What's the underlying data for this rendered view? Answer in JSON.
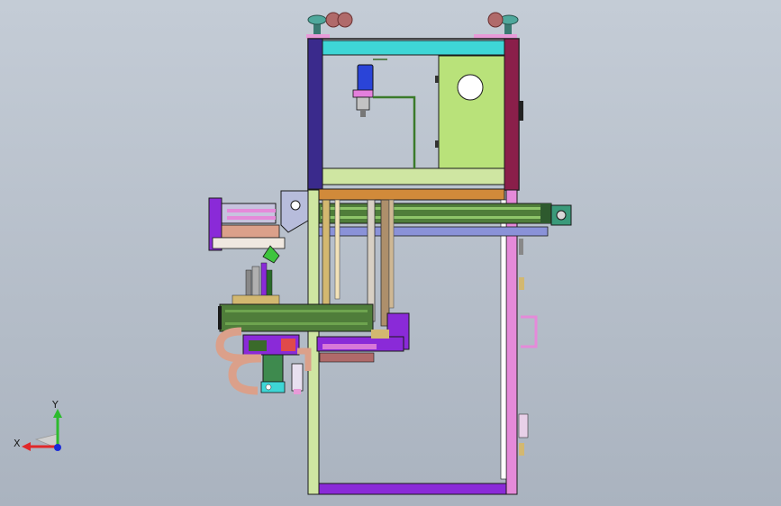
{
  "viewport": {
    "background_top": "#c4ccd6",
    "background_bottom": "#aab3bf"
  },
  "triad": {
    "x_label": "X",
    "y_label": "Y",
    "x_color": "#e0282a",
    "y_color": "#2dbb2d",
    "z_color": "#1a2bd8"
  },
  "palette": {
    "frame_green": "#cfe6a2",
    "frame_purple": "#8a2ad8",
    "frame_pink": "#e58ad9",
    "frame_navy": "#3a2a8c",
    "frame_maroon": "#8a1f4a",
    "cyan_bar": "#3ed6d6",
    "panel_green": "#b9e27a",
    "plate_orange": "#d18a3a",
    "rail_green": "#4f7d3a",
    "cylinder_blue": "#2a44d8",
    "pad_salmon": "#dba08a"
  },
  "icons": {
    "triad": "coordinate-triad-icon",
    "motor": "motor-icon",
    "knob": "leveling-foot-icon"
  }
}
